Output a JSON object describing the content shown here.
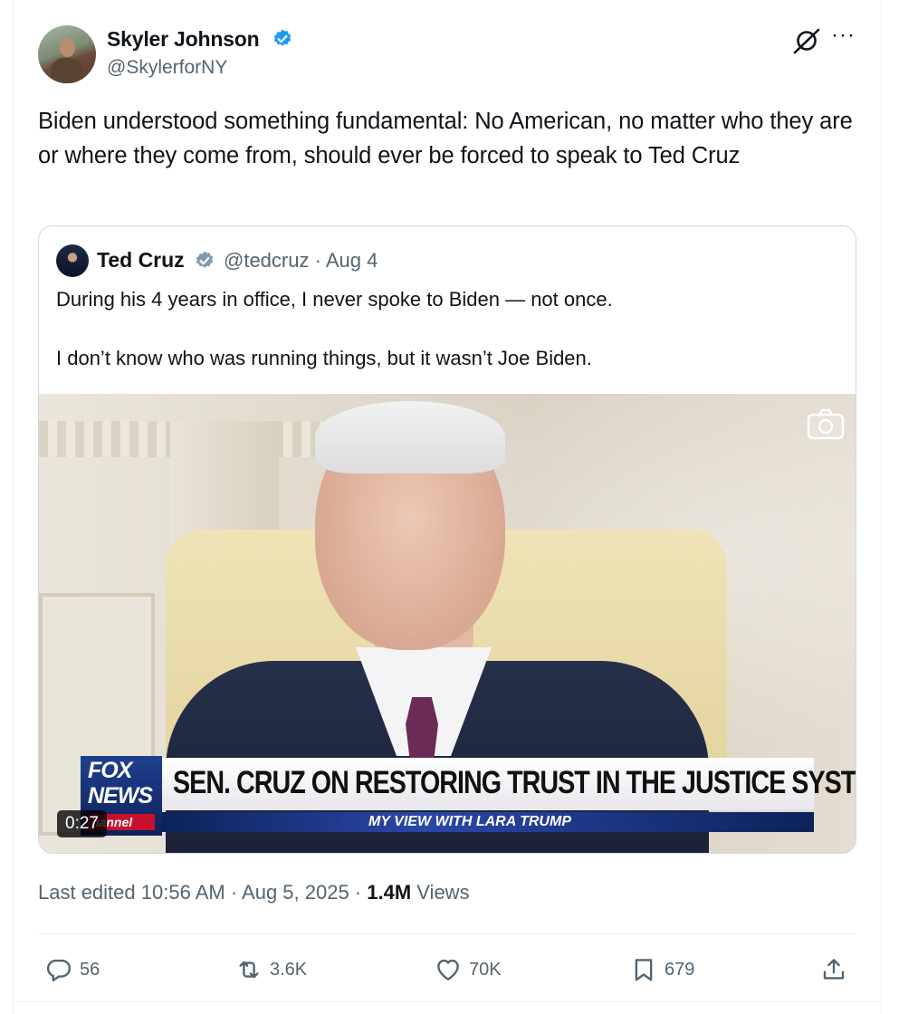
{
  "author": {
    "name": "Skyler Johnson",
    "handle": "@SkylerforNY",
    "verified_color": "#1d9bf0"
  },
  "tweet": {
    "text": "Biden understood something fundamental: No American, no matter who they are or where they come from, should ever be forced to speak to Ted Cruz"
  },
  "quote": {
    "name": "Ted Cruz",
    "meta": "@tedcruz · Aug 4",
    "verified_color": "#829aab",
    "text_line1": "During his 4 years in office, I never spoke to Biden — not once.",
    "text_line2": "I don’t know who was running things, but it wasn’t Joe Biden.",
    "video": {
      "duration": "0:27",
      "logo_top": "FOX",
      "logo_mid": "NEWS",
      "logo_bottom": "hannel",
      "headline": "SEN. CRUZ ON RESTORING TRUST IN THE JUSTICE SYSTEM",
      "strip": "MY VIEW WITH LARA TRUMP"
    }
  },
  "meta": {
    "edited_prefix": "Last edited 10:56 AM · Aug 5, 2025 · ",
    "views_count": "1.4M",
    "views_label": " Views"
  },
  "actions": {
    "replies": "56",
    "reposts": "3.6K",
    "likes": "70K",
    "bookmarks": "679"
  },
  "icons": [
    "grok-icon",
    "more-icon",
    "verified-badge-icon",
    "camera-icon",
    "reply-icon",
    "repost-icon",
    "like-icon",
    "bookmark-icon",
    "share-icon"
  ]
}
